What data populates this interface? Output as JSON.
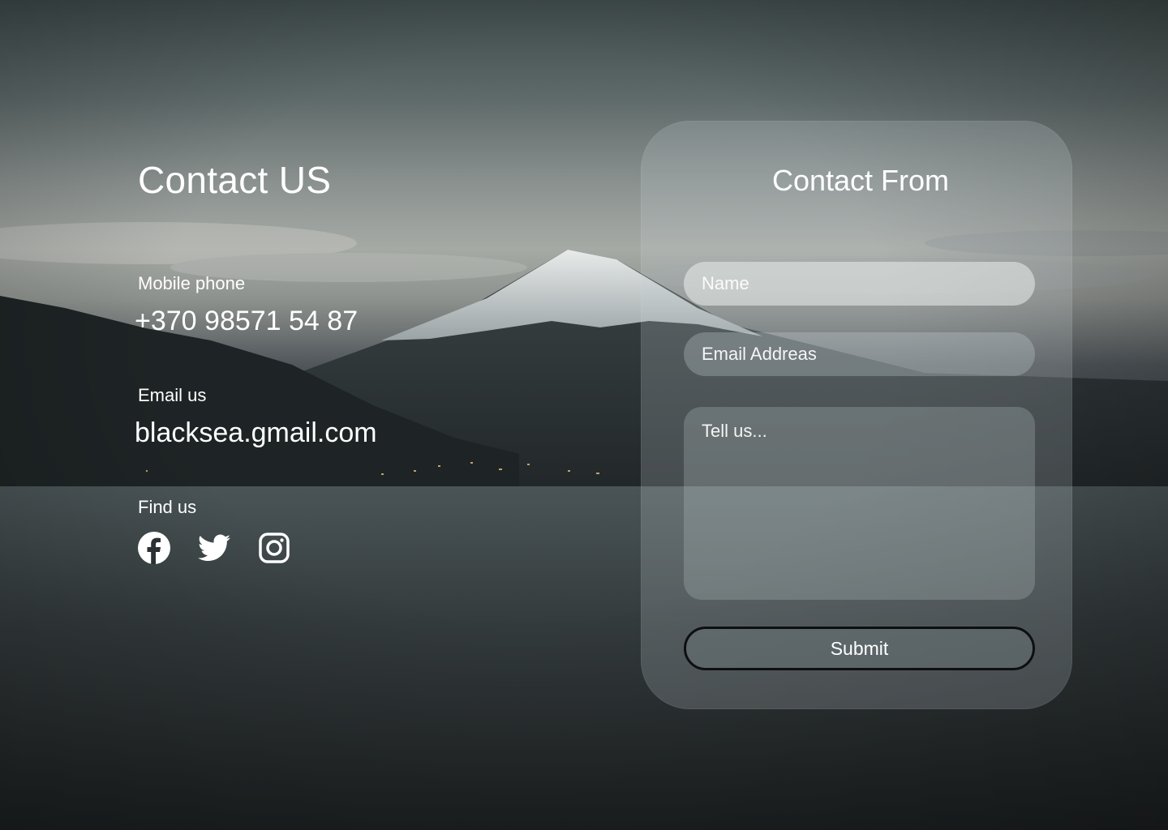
{
  "contact": {
    "title": "Contact US",
    "phone_label": "Mobile phone",
    "phone_value": "+370 98571 54 87",
    "email_label": "Email us",
    "email_value": "blacksea.gmail.com",
    "find_label": "Find us",
    "socials": [
      {
        "icon": "facebook-icon"
      },
      {
        "icon": "twitter-icon"
      },
      {
        "icon": "instagram-icon"
      }
    ]
  },
  "form": {
    "title": "Contact From",
    "name_placeholder": "Name",
    "email_placeholder": "Email Addreas",
    "message_placeholder": "Tell us...",
    "submit_label": "Submit"
  },
  "colors": {
    "text": "#ffffff",
    "submit_border": "#0d0f10"
  }
}
